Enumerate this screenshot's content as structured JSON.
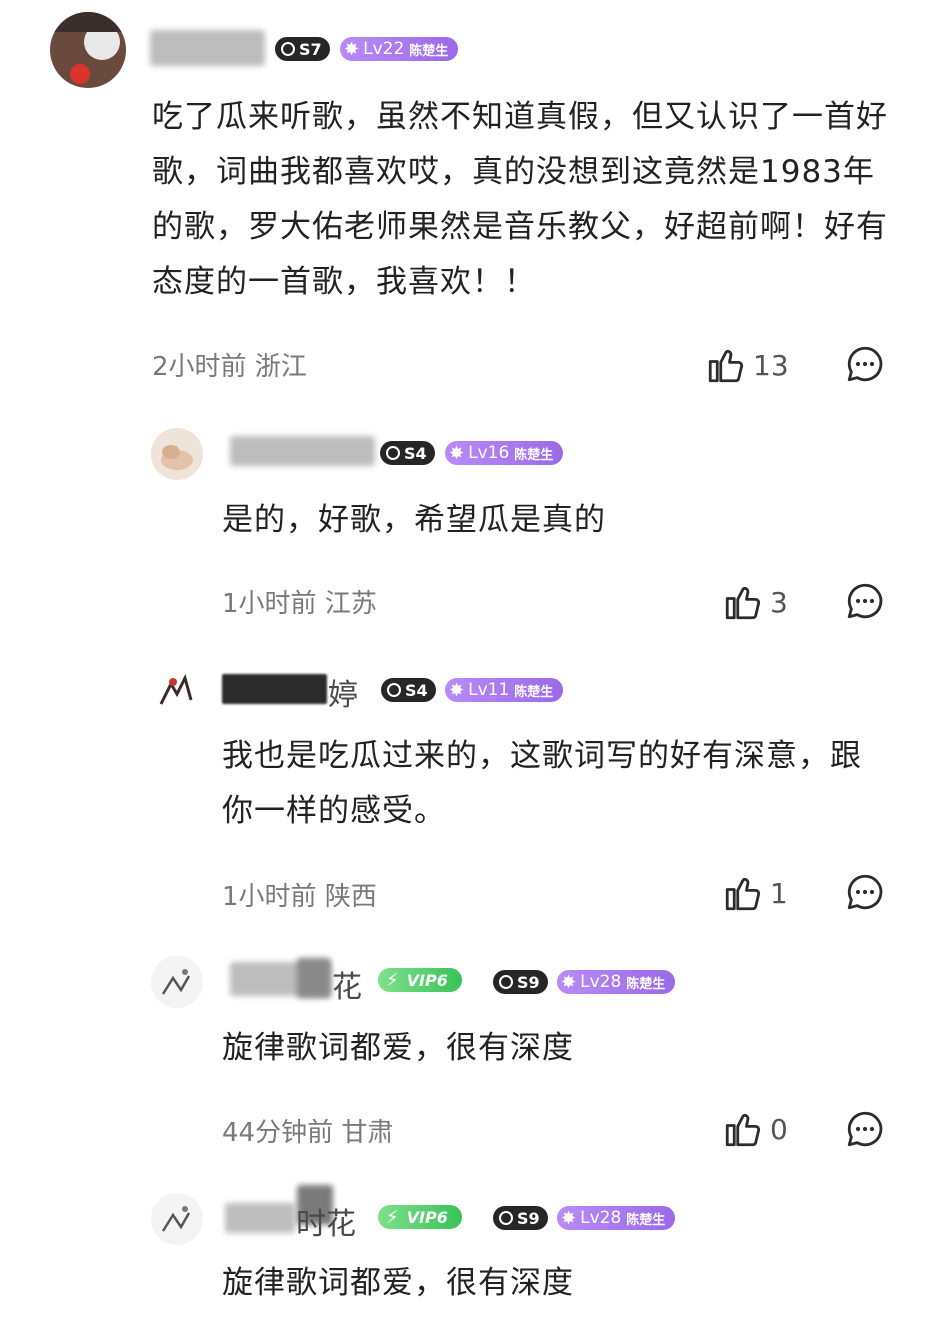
{
  "colors": {
    "level_badge": "#a77af0",
    "vip_badge": "#45c45f",
    "s_badge": "#262626"
  },
  "comments": [
    {
      "name_visible": "",
      "badges": {
        "season": "S7",
        "level": "Lv22",
        "level_name": "陈楚生"
      },
      "text": "吃了瓜来听歌，虽然不知道真假，但又认识了一首好歌，词曲我都喜欢哎，真的没想到这竟然是1983年的歌，罗大佑老师果然是音乐教父，好超前啊！好有态度的一首歌，我喜欢！！",
      "time": "2小时前",
      "location": "浙江",
      "likes": "13",
      "icons": {
        "like": "thumbs-up-icon",
        "reply": "comment-bubble-icon"
      }
    },
    {
      "name_visible": "",
      "badges": {
        "season": "S4",
        "level": "Lv16",
        "level_name": "陈楚生"
      },
      "text": "是的，好歌，希望瓜是真的",
      "time": "1小时前",
      "location": "江苏",
      "likes": "3"
    },
    {
      "name_visible": "婷",
      "badges": {
        "season": "S4",
        "level": "Lv11",
        "level_name": "陈楚生"
      },
      "text": "我也是吃瓜过来的，这歌词写的好有深意，跟你一样的感受。",
      "time": "1小时前",
      "location": "陕西",
      "likes": "1"
    },
    {
      "name_visible": "花",
      "badges": {
        "vip": "VIP6",
        "season": "S9",
        "level": "Lv28",
        "level_name": "陈楚生"
      },
      "text": "旋律歌词都爱，很有深度",
      "time": "44分钟前",
      "location": "甘肃",
      "likes": "0"
    },
    {
      "name_visible": "时花",
      "badges": {
        "vip": "VIP6",
        "season": "S9",
        "level": "Lv28",
        "level_name": "陈楚生"
      },
      "text": "旋律歌词都爱，很有深度"
    }
  ]
}
